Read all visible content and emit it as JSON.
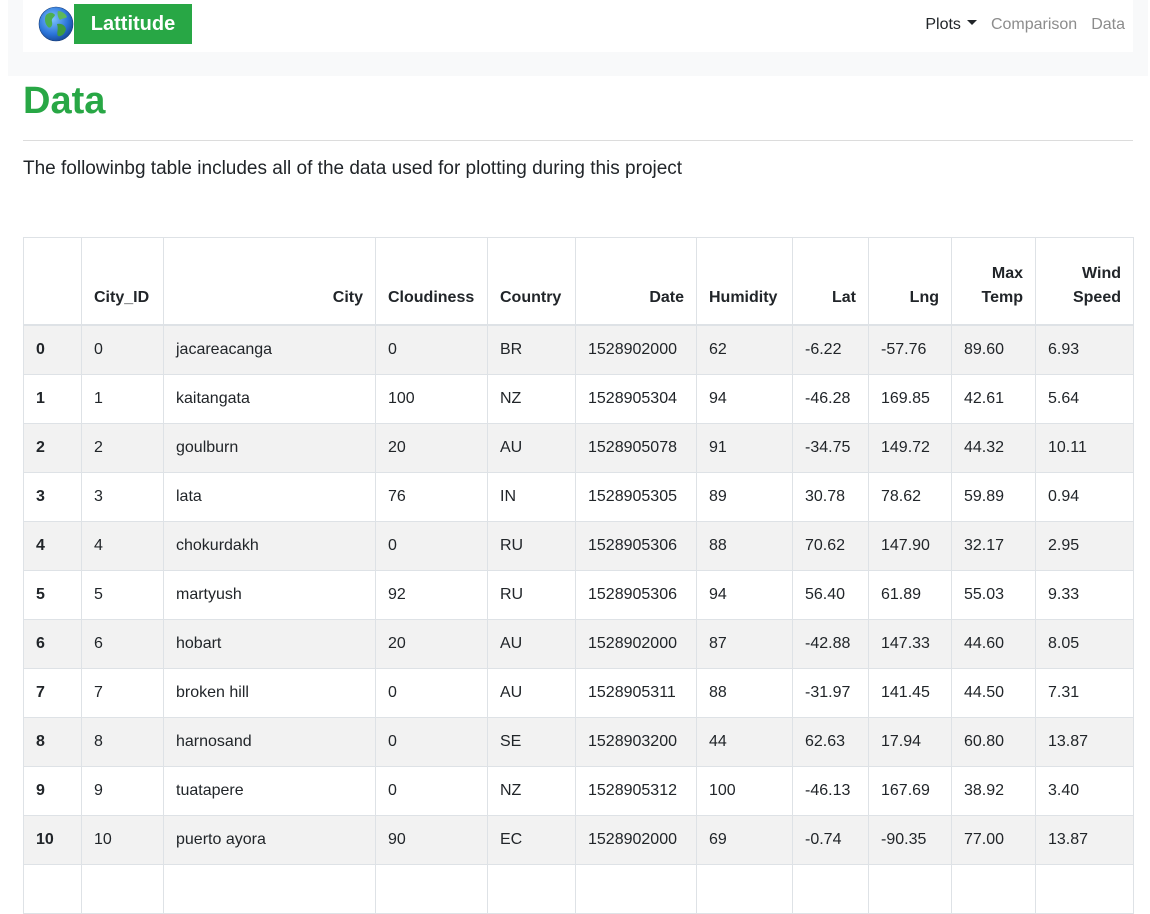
{
  "navbar": {
    "brand": "Lattitude",
    "globe_icon": "globe-icon",
    "links": {
      "plots": "Plots",
      "comparison": "Comparison",
      "data": "Data"
    }
  },
  "page": {
    "title": "Data",
    "intro": "The followinbg table includes all of the data used for plotting during this project"
  },
  "table": {
    "headers": {
      "city_id": "City_ID",
      "city": "City",
      "cloudiness": "Cloudiness",
      "country": "Country",
      "date": "Date",
      "humidity": "Humidity",
      "lat": "Lat",
      "lng": "Lng",
      "max_temp": "Max Temp",
      "wind_speed": "Wind Speed"
    },
    "rows": [
      {
        "index": "0",
        "city_id": "0",
        "city": "jacareacanga",
        "cloudiness": "0",
        "country": "BR",
        "date": "1528902000",
        "humidity": "62",
        "lat": "-6.22",
        "lng": "-57.76",
        "max_temp": "89.60",
        "wind_speed": "6.93"
      },
      {
        "index": "1",
        "city_id": "1",
        "city": "kaitangata",
        "cloudiness": "100",
        "country": "NZ",
        "date": "1528905304",
        "humidity": "94",
        "lat": "-46.28",
        "lng": "169.85",
        "max_temp": "42.61",
        "wind_speed": "5.64"
      },
      {
        "index": "2",
        "city_id": "2",
        "city": "goulburn",
        "cloudiness": "20",
        "country": "AU",
        "date": "1528905078",
        "humidity": "91",
        "lat": "-34.75",
        "lng": "149.72",
        "max_temp": "44.32",
        "wind_speed": "10.11"
      },
      {
        "index": "3",
        "city_id": "3",
        "city": "lata",
        "cloudiness": "76",
        "country": "IN",
        "date": "1528905305",
        "humidity": "89",
        "lat": "30.78",
        "lng": "78.62",
        "max_temp": "59.89",
        "wind_speed": "0.94"
      },
      {
        "index": "4",
        "city_id": "4",
        "city": "chokurdakh",
        "cloudiness": "0",
        "country": "RU",
        "date": "1528905306",
        "humidity": "88",
        "lat": "70.62",
        "lng": "147.90",
        "max_temp": "32.17",
        "wind_speed": "2.95"
      },
      {
        "index": "5",
        "city_id": "5",
        "city": "martyush",
        "cloudiness": "92",
        "country": "RU",
        "date": "1528905306",
        "humidity": "94",
        "lat": "56.40",
        "lng": "61.89",
        "max_temp": "55.03",
        "wind_speed": "9.33"
      },
      {
        "index": "6",
        "city_id": "6",
        "city": "hobart",
        "cloudiness": "20",
        "country": "AU",
        "date": "1528902000",
        "humidity": "87",
        "lat": "-42.88",
        "lng": "147.33",
        "max_temp": "44.60",
        "wind_speed": "8.05"
      },
      {
        "index": "7",
        "city_id": "7",
        "city": "broken hill",
        "cloudiness": "0",
        "country": "AU",
        "date": "1528905311",
        "humidity": "88",
        "lat": "-31.97",
        "lng": "141.45",
        "max_temp": "44.50",
        "wind_speed": "7.31"
      },
      {
        "index": "8",
        "city_id": "8",
        "city": "harnosand",
        "cloudiness": "0",
        "country": "SE",
        "date": "1528903200",
        "humidity": "44",
        "lat": "62.63",
        "lng": "17.94",
        "max_temp": "60.80",
        "wind_speed": "13.87"
      },
      {
        "index": "9",
        "city_id": "9",
        "city": "tuatapere",
        "cloudiness": "0",
        "country": "NZ",
        "date": "1528905312",
        "humidity": "100",
        "lat": "-46.13",
        "lng": "167.69",
        "max_temp": "38.92",
        "wind_speed": "3.40"
      },
      {
        "index": "10",
        "city_id": "10",
        "city": "puerto ayora",
        "cloudiness": "90",
        "country": "EC",
        "date": "1528902000",
        "humidity": "69",
        "lat": "-0.74",
        "lng": "-90.35",
        "max_temp": "77.00",
        "wind_speed": "13.87"
      },
      {
        "index": "",
        "city_id": "",
        "city": "",
        "cloudiness": "",
        "country": "",
        "date": "",
        "humidity": "",
        "lat": "",
        "lng": "",
        "max_temp": "",
        "wind_speed": ""
      }
    ]
  },
  "colors": {
    "brand_green": "#28a745",
    "stripe": "#f2f2f2",
    "nav_bg": "#f8f9fa"
  }
}
